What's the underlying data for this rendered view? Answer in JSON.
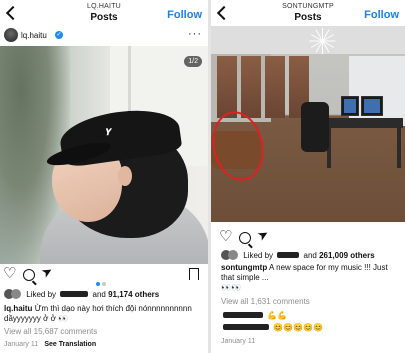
{
  "left_post": {
    "header_username_small": "LQ.HAITU",
    "header_title": "Posts",
    "follow_label": "Follow",
    "post_username": "lq.haitu",
    "more_label": "···",
    "image_counter": "1/2",
    "liked_prefix": "Liked by",
    "liked_and": "and",
    "liked_count": "91,174 others",
    "caption_username": "lq.haitu",
    "caption_text": "Ừm thì dạo này hơi thích đội nónnnnnnnnnn dầyyyyyyy ở ở 👀",
    "view_comments": "View all 15,687 comments",
    "date": "January 11",
    "see_translation": "See Translation"
  },
  "right_post": {
    "header_username_small": "SONTUNGMTP",
    "header_title": "Posts",
    "follow_label": "Follow",
    "liked_prefix": "Liked by",
    "liked_and": "and",
    "liked_count": "261,009 others",
    "caption_username": "sontungmtp",
    "caption_text": "A new space for my music !!! Just that simple ...",
    "caption_emoji": "👀👀",
    "view_comments": "View all 1,631 comments",
    "comment1_text": "💪💪",
    "comment2_text": "😊😊😊😊😊",
    "date": "January 11"
  },
  "colors": {
    "accent_blue": "#1f7fe0",
    "highlight_circle": "#e02020",
    "verified_badge": "#1f8bf0"
  },
  "icons": [
    "back-chevron-icon",
    "verified-icon",
    "more-icon",
    "heart-icon",
    "comment-icon",
    "send-icon",
    "bookmark-icon"
  ]
}
